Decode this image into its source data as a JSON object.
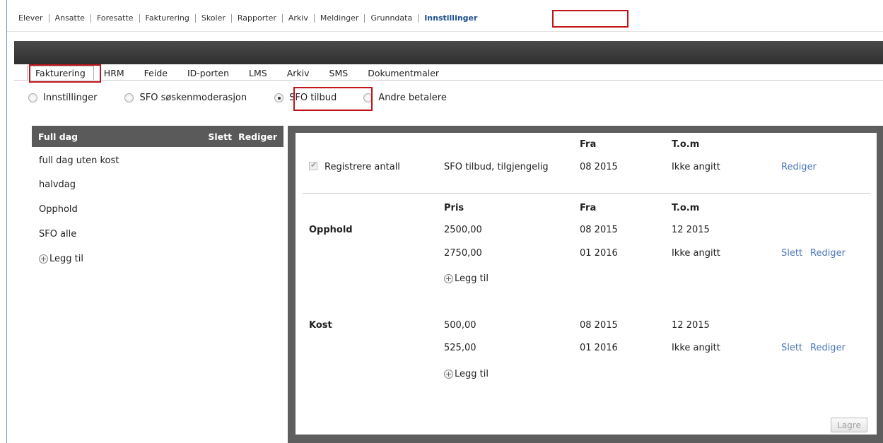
{
  "topnav": {
    "items": [
      "Elever",
      "Ansatte",
      "Foresatte",
      "Fakturering",
      "Skoler",
      "Rapporter",
      "Arkiv",
      "Meldinger",
      "Grunndata",
      "Innstillinger"
    ],
    "active": "Innstillinger"
  },
  "tabs": {
    "items": [
      "Fakturering",
      "HRM",
      "Feide",
      "ID-porten",
      "LMS",
      "Arkiv",
      "SMS",
      "Dokumentmaler"
    ],
    "active": "Fakturering"
  },
  "radios": {
    "items": [
      "Innstillinger",
      "SFO søskenmoderasjon",
      "SFO tilbud",
      "Andre betalere"
    ],
    "selected": "SFO tilbud"
  },
  "left": {
    "selected": "Full dag",
    "delete_label": "Slett",
    "edit_label": "Rediger",
    "items": [
      "full dag uten kost",
      "halvdag",
      "Opphold",
      "SFO alle"
    ],
    "add_label": "Legg til"
  },
  "right": {
    "top": {
      "fra_header": "Fra",
      "tom_header": "T.o.m",
      "checkbox_label": "Registrere antall",
      "availability": "SFO tilbud, tilgjengelig",
      "fra": "08 2015",
      "tom": "Ikke angitt",
      "edit_label": "Rediger"
    },
    "price_headers": {
      "pris": "Pris",
      "fra": "Fra",
      "tom": "T.o.m"
    },
    "groups": [
      {
        "name": "Opphold",
        "rows": [
          {
            "pris": "2500,00",
            "fra": "08 2015",
            "tom": "12 2015"
          },
          {
            "pris": "2750,00",
            "fra": "01 2016",
            "tom": "Ikke angitt",
            "delete": "Slett",
            "edit": "Rediger"
          }
        ],
        "add_label": "Legg til"
      },
      {
        "name": "Kost",
        "rows": [
          {
            "pris": "500,00",
            "fra": "08 2015",
            "tom": "12 2015"
          },
          {
            "pris": "525,00",
            "fra": "01 2016",
            "tom": "Ikke angitt",
            "delete": "Slett",
            "edit": "Rediger"
          }
        ],
        "add_label": "Legg til"
      }
    ],
    "save_label": "Lagre"
  }
}
